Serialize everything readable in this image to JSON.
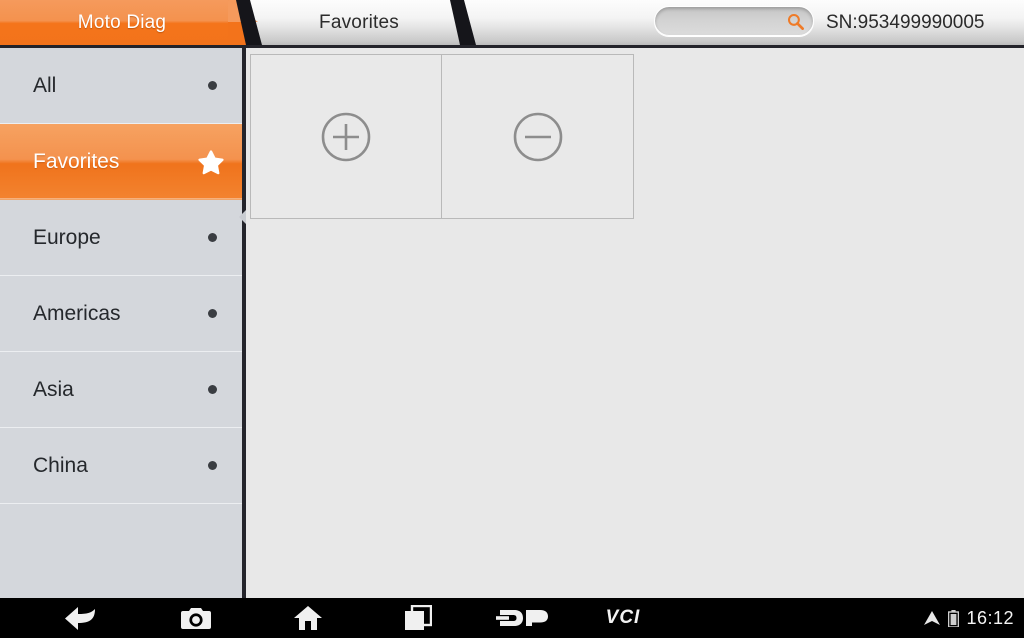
{
  "header": {
    "tabs": [
      {
        "label": "Moto Diag",
        "active": true
      },
      {
        "label": "Favorites",
        "active": false
      }
    ],
    "search": {
      "value": "",
      "placeholder": ""
    },
    "serial_number": "SN:953499990005"
  },
  "sidebar": {
    "items": [
      {
        "label": "All",
        "marker": "dot",
        "selected": false
      },
      {
        "label": "Favorites",
        "marker": "star",
        "selected": true
      },
      {
        "label": "Europe",
        "marker": "dot",
        "selected": false
      },
      {
        "label": "Americas",
        "marker": "dot",
        "selected": false
      },
      {
        "label": "Asia",
        "marker": "dot",
        "selected": false
      },
      {
        "label": "China",
        "marker": "dot",
        "selected": false
      }
    ]
  },
  "content": {
    "cells": [
      {
        "icon": "plus-circle-icon",
        "label": ""
      },
      {
        "icon": "minus-circle-icon",
        "label": ""
      }
    ]
  },
  "navbar": {
    "items": [
      {
        "name": "back-icon",
        "label": ""
      },
      {
        "name": "camera-icon",
        "label": ""
      },
      {
        "name": "home-icon",
        "label": ""
      },
      {
        "name": "recents-icon",
        "label": ""
      },
      {
        "name": "dp-logo",
        "label": "DP"
      },
      {
        "name": "vci-label",
        "label": "VCI"
      }
    ],
    "status": {
      "wifi": "wifi-icon",
      "battery": "battery-icon",
      "time": "16:12"
    }
  },
  "colors": {
    "accent_orange": "#f3731b",
    "accent_orange_light": "#f59a5c",
    "sidebar_bg": "#d4d7dc",
    "content_bg": "#e8e8e8",
    "navbar_bg": "#000000"
  }
}
